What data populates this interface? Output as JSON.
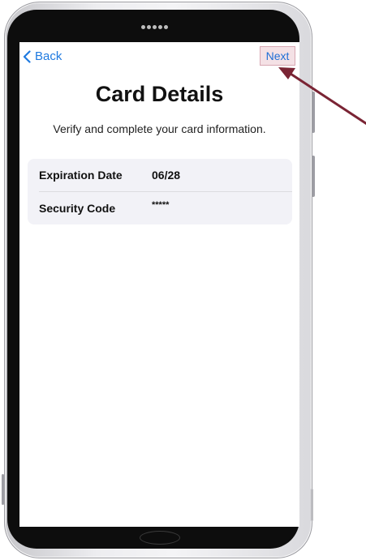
{
  "nav": {
    "back_label": "Back",
    "next_label": "Next"
  },
  "page": {
    "title": "Card Details",
    "subtitle": "Verify and complete your card information."
  },
  "card_fields": [
    {
      "label": "Expiration Date",
      "value": "06/28"
    },
    {
      "label": "Security Code",
      "value": "*****"
    }
  ],
  "icons": {
    "back": "chevron-left-icon",
    "annotation": "arrow-icon"
  },
  "colors": {
    "accent": "#1f7ae0",
    "next_highlight": "#f4e1e5",
    "arrow": "#7a2434",
    "card_background": "#f2f2f7"
  }
}
